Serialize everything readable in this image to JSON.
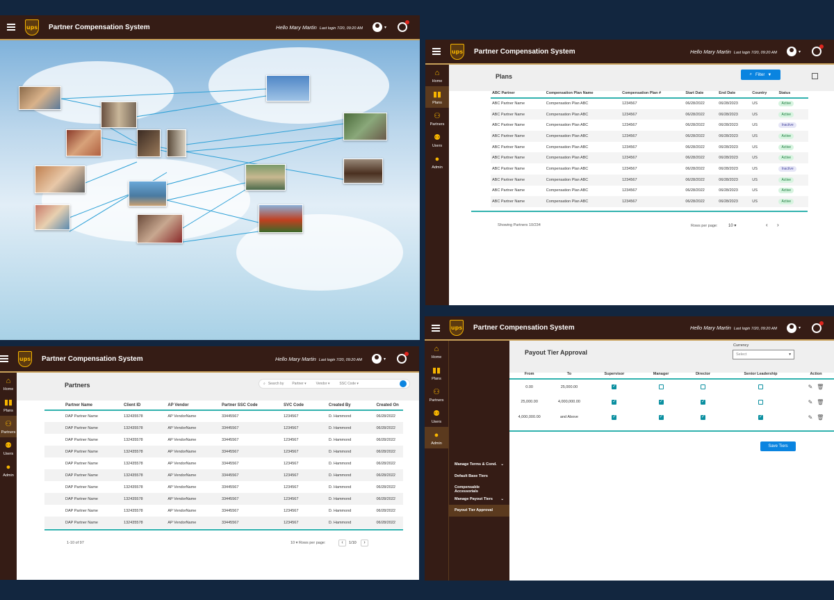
{
  "app": {
    "title": "Partner Compensation System",
    "greeting": "Hello Mary Martin",
    "last_login": "Last login 7/20, 09:20 AM",
    "logo_text": "ups"
  },
  "nav": [
    "Home",
    "Plans",
    "Partners",
    "Users",
    "Admin"
  ],
  "plans": {
    "title": "Plans",
    "filter_label": "Filter",
    "columns": [
      "ABC Partner",
      "Compensation Plan Name",
      "Compensation Plan #",
      "Start Date",
      "End Date",
      "Country",
      "Status"
    ],
    "rows": [
      [
        "ABC Partner Name",
        "Compensation Plan ABC",
        "1234567",
        "06/28/2022",
        "06/28/2023",
        "US",
        "Active"
      ],
      [
        "ABC Partner Name",
        "Compensation Plan ABC",
        "1234567",
        "06/28/2022",
        "06/28/2023",
        "US",
        "Active"
      ],
      [
        "ABC Partner Name",
        "Compensation Plan ABC",
        "1234567",
        "06/28/2022",
        "06/28/2023",
        "US",
        "Inactive"
      ],
      [
        "ABC Partner Name",
        "Compensation Plan ABC",
        "1234567",
        "06/28/2022",
        "06/28/2023",
        "US",
        "Active"
      ],
      [
        "ABC Partner Name",
        "Compensation Plan ABC",
        "1234567",
        "06/28/2022",
        "06/28/2023",
        "US",
        "Active"
      ],
      [
        "ABC Partner Name",
        "Compensation Plan ABC",
        "1234567",
        "06/28/2022",
        "06/28/2023",
        "US",
        "Active"
      ],
      [
        "ABC Partner Name",
        "Compensation Plan ABC",
        "1234567",
        "06/28/2022",
        "06/28/2023",
        "US",
        "Inactive"
      ],
      [
        "ABC Partner Name",
        "Compensation Plan ABC",
        "1234567",
        "06/28/2022",
        "06/28/2023",
        "US",
        "Active"
      ],
      [
        "ABC Partner Name",
        "Compensation Plan ABC",
        "1234567",
        "06/28/2022",
        "06/28/2023",
        "US",
        "Active"
      ],
      [
        "ABC Partner Name",
        "Compensation Plan ABC",
        "1234567",
        "06/28/2022",
        "06/28/2023",
        "US",
        "Active"
      ]
    ],
    "showing": "Showing Partners 10/234",
    "rows_per_page_label": "Rows per page:",
    "rows_per_page": "10",
    "prev": "‹",
    "next": "›"
  },
  "partners": {
    "title": "Partners",
    "search_by": "Search by",
    "filters": [
      "Partner",
      "Vendor",
      "SSC Code"
    ],
    "columns": [
      "Partner Name",
      "Client ID",
      "AP Vendor",
      "Partner SSC Code",
      "SVC Code",
      "Created By",
      "Created On"
    ],
    "rows": [
      [
        "DAP Partner Name",
        "132435578",
        "AP VendorName",
        "33445567",
        "1234567",
        "D. Hammond",
        "06/28/2022"
      ],
      [
        "DAP Partner Name",
        "132435578",
        "AP VendorName",
        "33445567",
        "1234567",
        "D. Hammond",
        "06/28/2022"
      ],
      [
        "DAP Partner Name",
        "132435578",
        "AP VendorName",
        "33445567",
        "1234567",
        "D. Hammond",
        "06/28/2022"
      ],
      [
        "DAP Partner Name",
        "132435578",
        "AP VendorName",
        "33445567",
        "1234567",
        "D. Hammond",
        "06/28/2022"
      ],
      [
        "DAP Partner Name",
        "132435578",
        "AP VendorName",
        "33445567",
        "1234567",
        "D. Hammond",
        "06/28/2022"
      ],
      [
        "DAP Partner Name",
        "132435578",
        "AP VendorName",
        "33445567",
        "1234567",
        "D. Hammond",
        "06/28/2022"
      ],
      [
        "DAP Partner Name",
        "132435578",
        "AP VendorName",
        "33445567",
        "1234567",
        "D. Hammond",
        "06/28/2022"
      ],
      [
        "DAP Partner Name",
        "132435578",
        "AP VendorName",
        "33445567",
        "1234567",
        "D. Hammond",
        "06/28/2022"
      ],
      [
        "DAP Partner Name",
        "132435578",
        "AP VendorName",
        "33445567",
        "1234567",
        "D. Hammond",
        "06/28/2022"
      ],
      [
        "DAP Partner Name",
        "132435578",
        "AP VendorName",
        "33445567",
        "1234567",
        "D. Hammond",
        "06/28/2022"
      ]
    ],
    "range": "1-10 of 97",
    "rows_per_page": "10",
    "rows_per_page_label": "Rows per page:",
    "page": "1/10",
    "prev": "‹",
    "next": "›"
  },
  "payout": {
    "title": "Payout Tier Approval",
    "currency_label": "Currency",
    "currency_placeholder": "Select",
    "columns": [
      "From",
      "To",
      "Supervisor",
      "Manager",
      "Director",
      "Senior Leadership",
      "Action"
    ],
    "rows": [
      {
        "from": "0.00",
        "to": "25,000.00",
        "checks": [
          true,
          false,
          false,
          false
        ]
      },
      {
        "from": "25,000.00",
        "to": "4,000,000.00",
        "checks": [
          true,
          true,
          true,
          false
        ]
      },
      {
        "from": "4,000,000.00",
        "to": "and Above",
        "checks": [
          true,
          true,
          true,
          true
        ]
      }
    ],
    "save_label": "Save Tiers",
    "submenu": [
      {
        "label": "Manage Terms & Cond.",
        "expand": "⌄",
        "active": false
      },
      {
        "label": "Default Base Tiers",
        "expand": "",
        "active": false
      },
      {
        "label": "Compensable Accessorials",
        "expand": "",
        "active": false
      },
      {
        "label": "Manage Payout Tiers",
        "expand": "⌄",
        "active": false
      },
      {
        "label": "Payout Tier Approval",
        "expand": "",
        "active": true
      }
    ]
  },
  "colors": {
    "brown": "#351c15",
    "gold": "#f7b500",
    "teal": "#2fb1ad",
    "blue": "#0a84e0"
  }
}
